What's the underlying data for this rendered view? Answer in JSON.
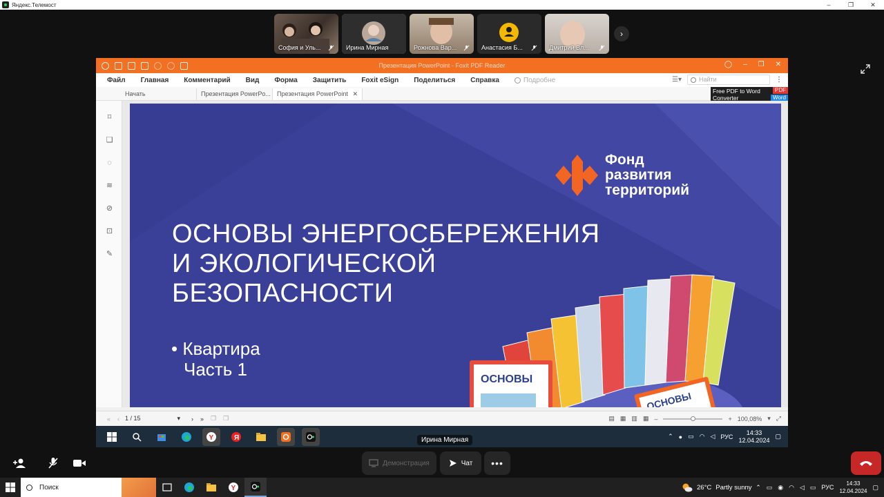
{
  "window": {
    "title": "Яндекс.Телемост",
    "controls": [
      "–",
      "❐",
      "✕"
    ]
  },
  "participants": [
    {
      "name": "София и Уль...",
      "active": false,
      "muted": true
    },
    {
      "name": "Ирина Мирная",
      "active": true,
      "muted": false
    },
    {
      "name": "Рожнова Вар...",
      "active": false,
      "muted": true
    },
    {
      "name": "Анастасия Б...",
      "active": false,
      "muted": true
    },
    {
      "name": "Дмитрий Вл...",
      "active": false,
      "muted": true
    }
  ],
  "foxit": {
    "title": "Презентация PowerPoint - Foxit PDF Reader",
    "menu": [
      "Файл",
      "Главная",
      "Комментарий",
      "Вид",
      "Форма",
      "Защитить",
      "Foxit eSign",
      "Поделиться",
      "Справка"
    ],
    "tell_me": "Подробне",
    "find_placeholder": "Найти",
    "tabs": [
      "Начать",
      "Презентация PowerPo...",
      "Презентация PowerPoint"
    ],
    "ad": {
      "line1": "Free PDF to Word",
      "line2": "Converter",
      "pdf": "PDF",
      "word": "Word"
    },
    "status": {
      "page": "1 / 15",
      "zoom": "100,08%"
    }
  },
  "slide": {
    "brand": [
      "Фонд",
      "развития",
      "территорий"
    ],
    "heading": [
      "ОСНОВЫ ЭНЕРГОСБЕРЕЖЕНИЯ",
      "И ЭКОЛОГИЧЕСКОЙ",
      "БЕЗОПАСНОСТИ"
    ],
    "bullet": [
      "• Квартира",
      "Часть 1"
    ],
    "book_title": "ОСНОВЫ"
  },
  "shared_taskbar": {
    "lang": "РУС",
    "time": "14:33",
    "date": "12.04.2024"
  },
  "presenter_label": "Ирина Мирная",
  "controls": {
    "demo": "Демонстрация",
    "chat": "Чат"
  },
  "win_taskbar": {
    "search": "Поиск",
    "weather_temp": "26°C",
    "weather_text": "Partly sunny",
    "lang": "РУС",
    "time": "14:33",
    "date": "12.04.2024"
  }
}
